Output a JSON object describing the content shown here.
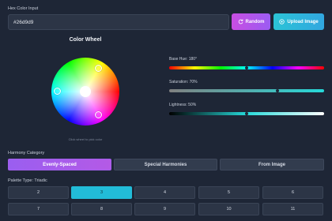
{
  "hex": {
    "label": "Hex Color Input",
    "value": "#26d9d9"
  },
  "buttons": {
    "random": "Random",
    "upload": "Upload Image"
  },
  "icons": {
    "random": "refresh-icon",
    "upload": "upload-image-icon"
  },
  "wheel": {
    "title": "Color Wheel",
    "hint": "Click wheel to pick color",
    "markers": 3
  },
  "sliders": {
    "hue": {
      "label": "Base Hue: 180°",
      "value": 180,
      "max": 360
    },
    "saturation": {
      "label": "Saturation: 70%",
      "value": 70,
      "max": 100
    },
    "lightness": {
      "label": "Lightness: 50%",
      "value": 50,
      "max": 100
    }
  },
  "harmony": {
    "label": "Harmony Category",
    "options": [
      "Evenly-Spaced",
      "Special Harmonies",
      "From Image"
    ],
    "selected": "Evenly-Spaced"
  },
  "palette": {
    "label": "Palette Type: Triadic",
    "options": [
      "2",
      "3",
      "4",
      "5",
      "6",
      "7",
      "8",
      "9",
      "10",
      "11"
    ],
    "selected": "3"
  },
  "colors": {
    "background": "#1e2636",
    "accent_purple": "#9a5ef0",
    "accent_cyan": "#22bcd8",
    "current": "#26d9d9"
  }
}
